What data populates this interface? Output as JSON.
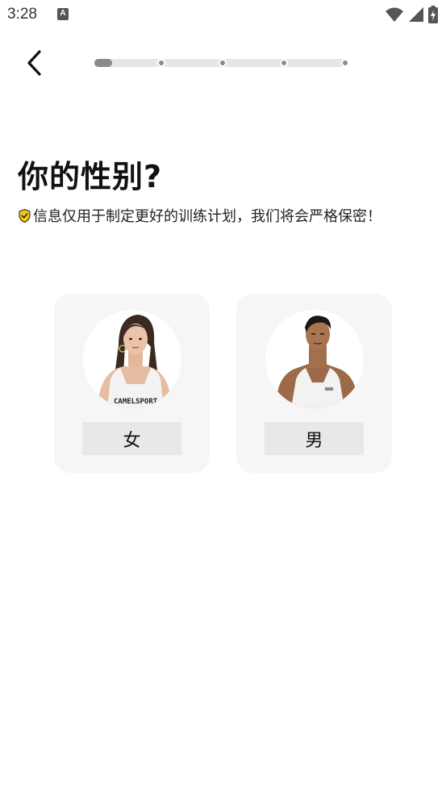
{
  "status_bar": {
    "time": "3:28",
    "app_icon_letter": "A",
    "icons": [
      "app-notification-icon",
      "wifi-icon",
      "signal-icon",
      "battery-charging-icon"
    ]
  },
  "header": {
    "back_icon": "chevron-left-icon",
    "progress": {
      "current_step": 1,
      "total_steps": 5
    }
  },
  "main": {
    "title": "你的性别?",
    "privacy_icon": "shield-check-icon",
    "privacy_note": "信息仅用于制定更好的训练计划，我们将会严格保密！",
    "options": [
      {
        "label": "女",
        "avatar_text": "CAMELSPORT"
      },
      {
        "label": "男"
      }
    ]
  },
  "colors": {
    "accent_shield": "#f5c518",
    "card_bg": "#f6f6f6",
    "label_bg": "#e8e8e8",
    "progress_active": "#8a8a8a"
  }
}
